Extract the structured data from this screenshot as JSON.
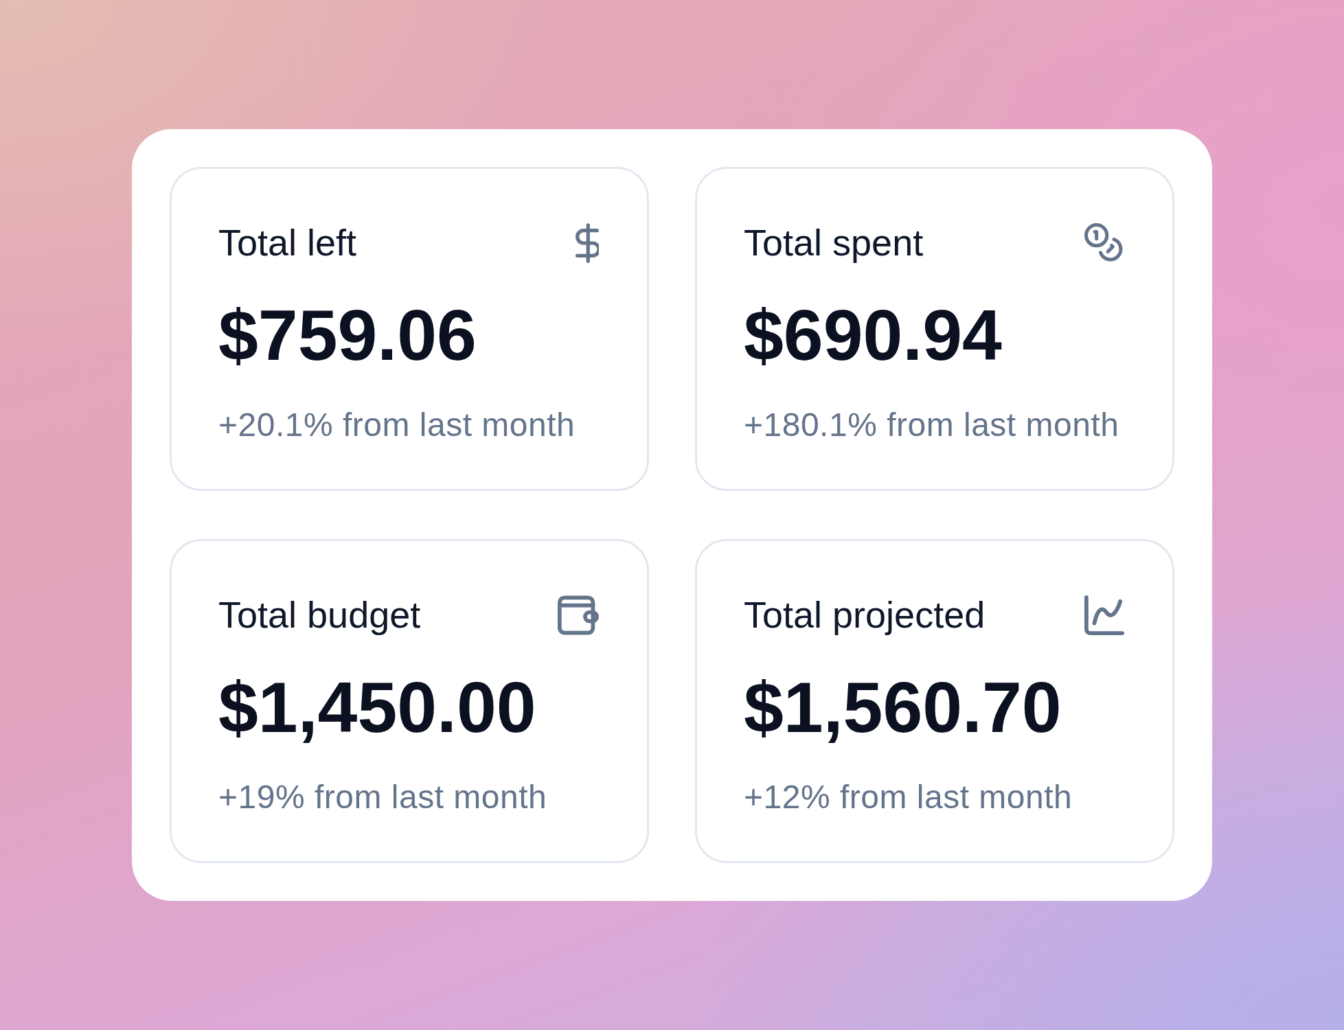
{
  "cards": [
    {
      "kind": "dollar",
      "title": "Total left",
      "value": "$759.06",
      "change": "+20.1% from last month"
    },
    {
      "kind": "coins",
      "title": "Total spent",
      "value": "$690.94",
      "change": "+180.1% from last month"
    },
    {
      "kind": "wallet",
      "title": "Total budget",
      "value": "$1,450.00",
      "change": "+19% from last month"
    },
    {
      "kind": "chart",
      "title": "Total projected",
      "value": "$1,560.70",
      "change": "+12% from last month"
    }
  ]
}
